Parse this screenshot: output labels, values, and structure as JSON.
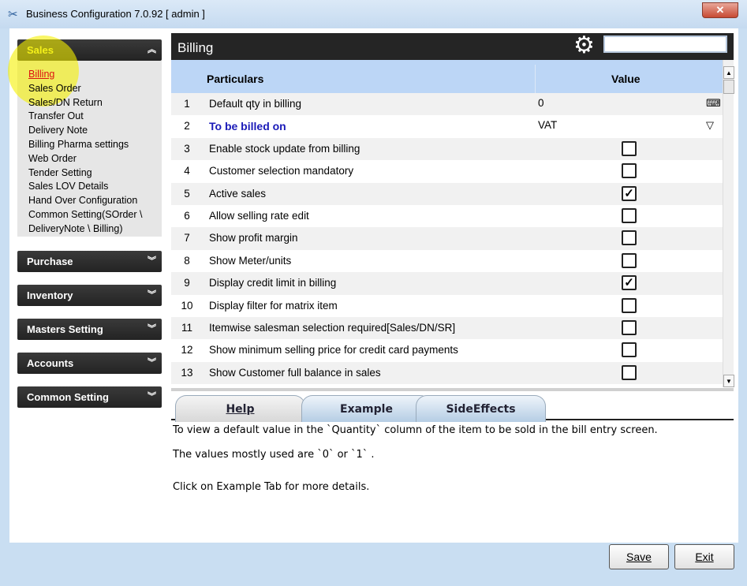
{
  "window": {
    "title": "Business Configuration 7.0.92 [ admin ]",
    "close": "✕"
  },
  "sidebar": {
    "sales": {
      "label": "Sales",
      "items": [
        "Billing",
        "Sales Order",
        "Sales/DN Return",
        "Transfer Out",
        "Delivery Note",
        "Billing Pharma settings",
        "Web Order",
        "Tender Setting",
        "Sales LOV Details",
        "Hand Over Configuration",
        "Common Setting(SOrder \\",
        "DeliveryNote \\ Billing)"
      ]
    },
    "sections": [
      "Purchase",
      "Inventory",
      "Masters Setting",
      "Accounts",
      "Common Setting"
    ]
  },
  "main": {
    "title": "Billing",
    "search_value": "",
    "columns": {
      "particulars": "Particulars",
      "value": "Value"
    },
    "rows": [
      {
        "n": "1",
        "label": "Default qty in  billing",
        "type": "text",
        "value": "0",
        "icon": "keyboard-icon"
      },
      {
        "n": "2",
        "label": "To be billed on",
        "type": "select",
        "value": "VAT",
        "bold": true
      },
      {
        "n": "3",
        "label": "Enable stock update from billing",
        "type": "check",
        "checked": false
      },
      {
        "n": "4",
        "label": "Customer selection mandatory",
        "type": "check",
        "checked": false
      },
      {
        "n": "5",
        "label": "Active sales",
        "type": "check",
        "checked": true
      },
      {
        "n": "6",
        "label": "Allow selling rate edit",
        "type": "check",
        "checked": false
      },
      {
        "n": "7",
        "label": "Show profit margin",
        "type": "check",
        "checked": false
      },
      {
        "n": "8",
        "label": "Show Meter/units",
        "type": "check",
        "checked": false
      },
      {
        "n": "9",
        "label": "Display credit limit in billing",
        "type": "check",
        "checked": true
      },
      {
        "n": "10",
        "label": "Display filter for matrix item",
        "type": "check",
        "checked": false
      },
      {
        "n": "11",
        "label": "Itemwise salesman selection required[Sales/DN/SR]",
        "type": "check",
        "checked": false
      },
      {
        "n": "12",
        "label": "Show minimum selling price for credit card payments",
        "type": "check",
        "checked": false
      },
      {
        "n": "13",
        "label": "Show Customer full balance in sales",
        "type": "check",
        "checked": false
      }
    ]
  },
  "tabs": [
    "Help",
    "Example",
    "SideEffects"
  ],
  "help": {
    "lines": [
      "To view a default value in the `Quantity` column of the item to be sold  in the bill entry screen.",
      "The values mostly used are `0` or `1` .",
      "Click on Example Tab for more details."
    ]
  },
  "buttons": {
    "save": "Save",
    "exit": "Exit"
  }
}
